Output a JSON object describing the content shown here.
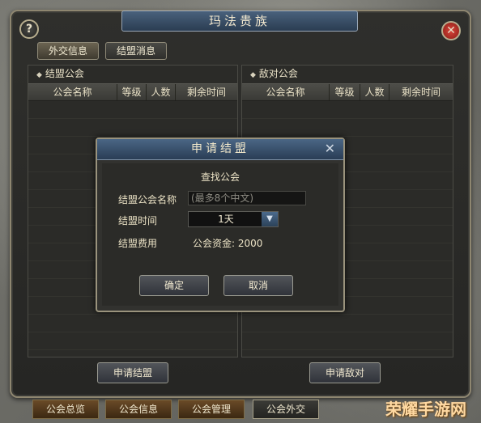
{
  "window": {
    "title": "玛法贵族"
  },
  "tabs": [
    {
      "label": "外交信息"
    },
    {
      "label": "结盟消息"
    }
  ],
  "left_panel": {
    "title": "结盟公会",
    "columns": [
      "公会名称",
      "等级",
      "人数",
      "剩余时间"
    ]
  },
  "right_panel": {
    "title": "敌对公会",
    "columns": [
      "公会名称",
      "等级",
      "人数",
      "剩余时间"
    ]
  },
  "bottom_buttons": {
    "apply_alliance": "申请结盟",
    "apply_hostile": "申请敌对"
  },
  "footer_tabs": [
    {
      "label": "公会总览"
    },
    {
      "label": "公会信息"
    },
    {
      "label": "公会管理"
    },
    {
      "label": "公会外交"
    }
  ],
  "dialog": {
    "title": "申请结盟",
    "heading": "查找公会",
    "name_label": "结盟公会名称",
    "name_placeholder": "(最多8个中文)",
    "time_label": "结盟时间",
    "time_value": "1天",
    "fee_label": "结盟费用",
    "fee_value": "公会资金: 2000",
    "confirm": "确定",
    "cancel": "取消"
  },
  "watermark": "荣耀手游网"
}
